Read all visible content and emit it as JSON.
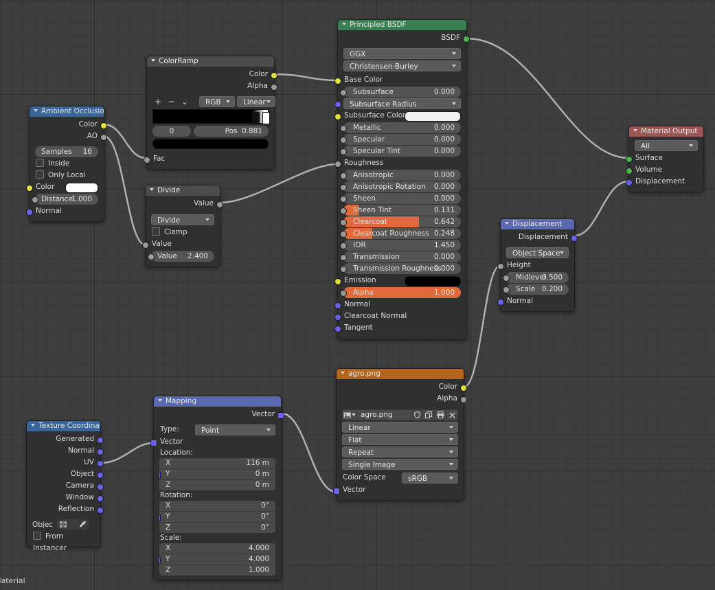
{
  "editor": {
    "status_text": "Material",
    "background_color": "#3e3e3e"
  },
  "nodes": [
    {
      "id": "ambient-occlusion",
      "title": "Ambient Occlusion",
      "header_color": "#3a6598",
      "outputs": [
        {
          "label": "Color",
          "socket": "yellow"
        },
        {
          "label": "AO",
          "socket": "gray"
        }
      ],
      "fields": {
        "samples_label": "Samples",
        "samples_value": "16",
        "inside_label": "Inside",
        "only_local_label": "Only Local",
        "color_label": "Color",
        "color_value": "#ffffff",
        "distance_label": "Distance",
        "distance_value": "1.000",
        "normal_label": "Normal"
      }
    },
    {
      "id": "colorramp",
      "title": "ColorRamp",
      "header_color": "#4c4c4c",
      "outputs": [
        {
          "label": "Color",
          "socket": "yellow"
        },
        {
          "label": "Alpha",
          "socket": "gray"
        }
      ],
      "fields": {
        "add_label": "+",
        "remove_label": "−",
        "menu_label": "⌄",
        "interpolation_mode": "RGB",
        "interpolation_type": "Linear",
        "index_value": "0",
        "pos_label": "Pos",
        "pos_value": "0.881",
        "fac_label": "Fac"
      }
    },
    {
      "id": "divide",
      "title": "Divide",
      "header_color": "#4c4c4c",
      "outputs": [
        {
          "label": "Value",
          "socket": "gray"
        }
      ],
      "fields": {
        "operation": "Divide",
        "clamp_label": "Clamp",
        "value1_label": "Value",
        "value2_label": "Value",
        "value2_value": "2.400"
      }
    },
    {
      "id": "principled-bsdf",
      "title": "Principled BSDF",
      "header_color": "#3a7f52",
      "outputs": [
        {
          "label": "BSDF",
          "socket": "green"
        }
      ],
      "distribution": "GGX",
      "subsurface_method": "Christensen-Burley",
      "inputs": [
        {
          "label": "Base Color",
          "socket": "yellow",
          "kind": "label"
        },
        {
          "label": "Subsurface",
          "socket": "gray",
          "kind": "value",
          "value": "0.000",
          "fill": 0
        },
        {
          "label": "Subsurface Radius",
          "socket": "purple",
          "kind": "select"
        },
        {
          "label": "Subsurface Color",
          "socket": "yellow",
          "kind": "swatch",
          "color": "#f2f2f0"
        },
        {
          "label": "Metallic",
          "socket": "gray",
          "kind": "value",
          "value": "0.000",
          "fill": 0
        },
        {
          "label": "Specular",
          "socket": "gray",
          "kind": "value",
          "value": "0.000",
          "fill": 0
        },
        {
          "label": "Specular Tint",
          "socket": "gray",
          "kind": "value",
          "value": "0.000",
          "fill": 0
        },
        {
          "label": "Roughness",
          "socket": "gray",
          "kind": "label"
        },
        {
          "label": "Anisotropic",
          "socket": "gray",
          "kind": "value",
          "value": "0.000",
          "fill": 0
        },
        {
          "label": "Anisotropic Rotation",
          "socket": "gray",
          "kind": "value",
          "value": "0.000",
          "fill": 0
        },
        {
          "label": "Sheen",
          "socket": "gray",
          "kind": "value",
          "value": "0.000",
          "fill": 0
        },
        {
          "label": "Sheen Tint",
          "socket": "gray",
          "kind": "value",
          "value": "0.131",
          "fill": 13.1
        },
        {
          "label": "Clearcoat",
          "socket": "gray",
          "kind": "value",
          "value": "0.642",
          "fill": 64.2
        },
        {
          "label": "Clearcoat Roughness",
          "socket": "gray",
          "kind": "value",
          "value": "0.248",
          "fill": 24.8
        },
        {
          "label": "IOR",
          "socket": "gray",
          "kind": "value",
          "value": "1.450",
          "fill": 0
        },
        {
          "label": "Transmission",
          "socket": "gray",
          "kind": "value",
          "value": "0.000",
          "fill": 0
        },
        {
          "label": "Transmission Roughness",
          "socket": "gray",
          "kind": "value",
          "value": "0.000",
          "fill": 0
        },
        {
          "label": "Emission",
          "socket": "yellow",
          "kind": "swatch",
          "color": "#000000"
        },
        {
          "label": "Alpha",
          "socket": "gray",
          "kind": "value",
          "value": "1.000",
          "fill": 100
        },
        {
          "label": "Normal",
          "socket": "purple",
          "kind": "label"
        },
        {
          "label": "Clearcoat Normal",
          "socket": "purple",
          "kind": "label"
        },
        {
          "label": "Tangent",
          "socket": "purple",
          "kind": "label"
        }
      ]
    },
    {
      "id": "material-output",
      "title": "Material Output",
      "header_color": "#9c5656",
      "target": "All",
      "inputs": [
        {
          "label": "Surface",
          "socket": "green"
        },
        {
          "label": "Volume",
          "socket": "green"
        },
        {
          "label": "Displacement",
          "socket": "purple"
        }
      ]
    },
    {
      "id": "displacement",
      "title": "Displacement",
      "header_color": "#5a69b0",
      "outputs": [
        {
          "label": "Displacement",
          "socket": "purple"
        }
      ],
      "space": "Object Space",
      "inputs": [
        {
          "label": "Height",
          "socket": "gray",
          "kind": "label"
        },
        {
          "label": "Midlevel",
          "socket": "gray",
          "kind": "value",
          "value": "0.500"
        },
        {
          "label": "Scale",
          "socket": "gray",
          "kind": "value",
          "value": "0.200"
        },
        {
          "label": "Normal",
          "socket": "purple",
          "kind": "label"
        }
      ]
    },
    {
      "id": "image-texture",
      "title": "agro.png",
      "header_color": "#b5651d",
      "outputs": [
        {
          "label": "Color",
          "socket": "yellow"
        },
        {
          "label": "Alpha",
          "socket": "gray"
        }
      ],
      "image_name": "agro.png",
      "interpolation": "Linear",
      "projection": "Flat",
      "extension": "Repeat",
      "source": "Single Image",
      "color_space_label": "Color Space",
      "color_space_value": "sRGB",
      "vector_label": "Vector"
    },
    {
      "id": "mapping",
      "title": "Mapping",
      "header_color": "#5a69b0",
      "outputs": [
        {
          "label": "Vector",
          "socket": "purple"
        }
      ],
      "type_label": "Type:",
      "type_value": "Point",
      "vector_label": "Vector",
      "location_label": "Location:",
      "location": [
        {
          "axis": "X",
          "value": "116 m"
        },
        {
          "axis": "Y",
          "value": "0 m"
        },
        {
          "axis": "Z",
          "value": "0 m"
        }
      ],
      "rotation_label": "Rotation:",
      "rotation": [
        {
          "axis": "X",
          "value": "0°"
        },
        {
          "axis": "Y",
          "value": "0°"
        },
        {
          "axis": "Z",
          "value": "0°"
        }
      ],
      "scale_label": "Scale:",
      "scale": [
        {
          "axis": "X",
          "value": "4.000"
        },
        {
          "axis": "Y",
          "value": "4.000"
        },
        {
          "axis": "Z",
          "value": "1.000"
        }
      ]
    },
    {
      "id": "texture-coordinate",
      "title": "Texture Coordinate",
      "header_color": "#3a6598",
      "outputs": [
        {
          "label": "Generated",
          "socket": "purple"
        },
        {
          "label": "Normal",
          "socket": "purple"
        },
        {
          "label": "UV",
          "socket": "purple"
        },
        {
          "label": "Object",
          "socket": "purple"
        },
        {
          "label": "Camera",
          "socket": "purple"
        },
        {
          "label": "Window",
          "socket": "purple"
        },
        {
          "label": "Reflection",
          "socket": "purple"
        }
      ],
      "object_label": "Objec",
      "from_instancer_label": "From Instancer"
    }
  ],
  "socket_colors": {
    "gray": "#9a9a9a",
    "yellow": "#e2e23f",
    "green": "#4eb54e",
    "purple": "#6a62eb"
  },
  "wire_color": "#c8c8c8"
}
